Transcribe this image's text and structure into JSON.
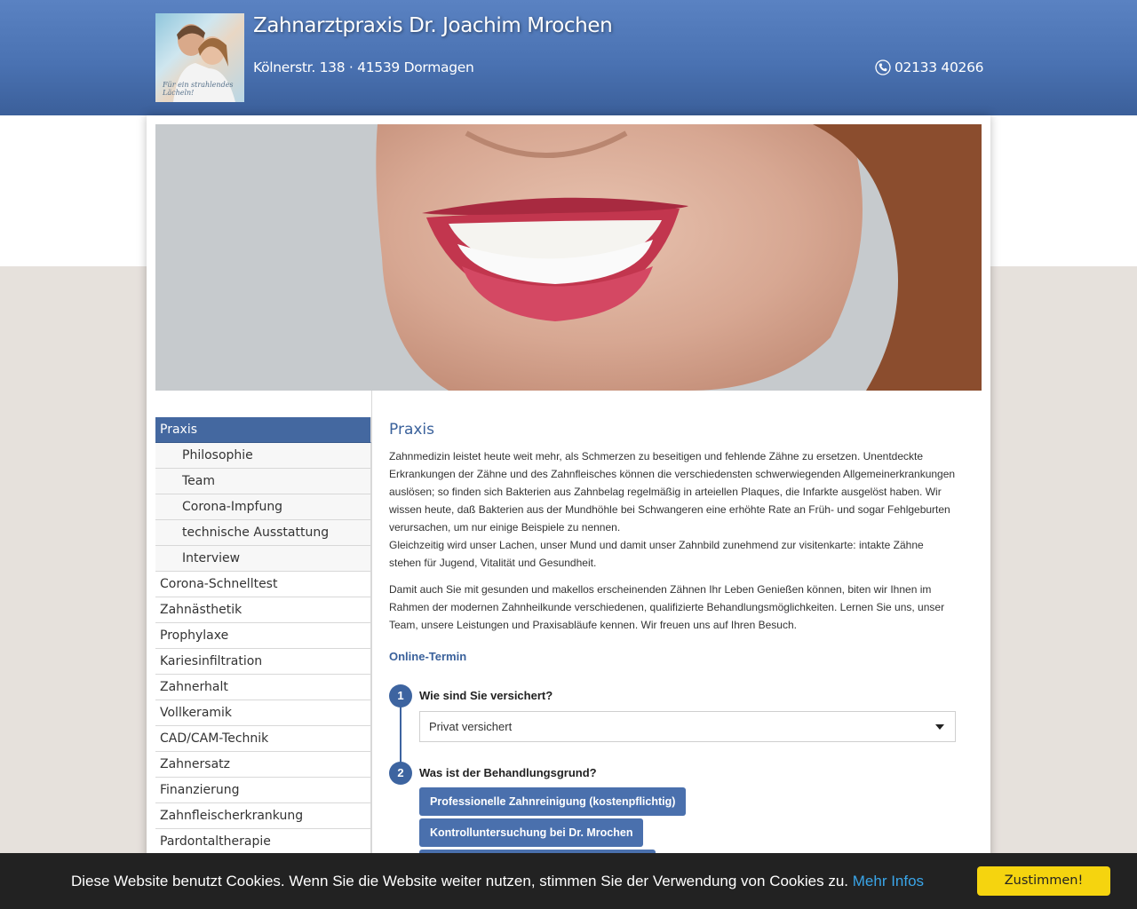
{
  "header": {
    "title": "Zahnarztpraxis Dr. Joachim Mrochen",
    "address": "Kölnerstr. 138 · 41539 Dormagen",
    "phone": "02133 40266",
    "logo_script": "Für ein strahlendes Lächeln!"
  },
  "hero": {
    "alt": "Lächelnde Frau mit weißen Zähnen"
  },
  "sidebar": {
    "items": [
      {
        "label": "Praxis",
        "active": true
      },
      {
        "label": "Philosophie",
        "sub": true
      },
      {
        "label": "Team",
        "sub": true
      },
      {
        "label": "Corona-Impfung",
        "sub": true
      },
      {
        "label": "technische Ausstattung",
        "sub": true
      },
      {
        "label": "Interview",
        "sub": true
      },
      {
        "label": "Corona-Schnelltest"
      },
      {
        "label": "Zahnästhetik"
      },
      {
        "label": "Prophylaxe"
      },
      {
        "label": "Kariesinfiltration"
      },
      {
        "label": "Zahnerhalt"
      },
      {
        "label": "Vollkeramik"
      },
      {
        "label": "CAD/CAM-Technik"
      },
      {
        "label": "Zahnersatz"
      },
      {
        "label": "Finanzierung"
      },
      {
        "label": "Zahnfleischerkrankung"
      },
      {
        "label": "Pardontaltherapie"
      }
    ]
  },
  "content": {
    "heading": "Praxis",
    "paragraph1": "Zahnmedizin leistet heute weit mehr, als Schmerzen zu beseitigen und fehlende Zähne zu ersetzen. Unentdeckte Erkrankungen der Zähne und des Zahnfleisches können die verschiedensten schwerwiegenden Allgemeinerkrankungen auslösen; so finden sich Bakterien aus Zahnbelag regelmäßig in arteiellen Plaques, die Infarkte ausgelöst haben. Wir wissen heute, daß Bakterien aus der Mundhöhle bei Schwangeren eine erhöhte Rate an Früh- und sogar Fehlgeburten verursachen, um nur einige Beispiele zu nennen.",
    "paragraph1b": "Gleichzeitig wird unser Lachen, unser Mund und damit unser Zahnbild zunehmend zur visitenkarte: intakte Zähne stehen für Jugend, Vitalität und Gesundheit.",
    "paragraph2": "Damit auch Sie mit gesunden und makellos erscheinenden Zähnen Ihr Leben Genießen können, biten wir Ihnen im Rahmen der modernen Zahnheilkunde verschiedenen, qualifizierte Behandlungsmöglichkeiten. Lernen Sie uns, unser Team, unsere Leistungen und Praxisabläufe kennen. Wir freuen uns auf Ihren Besuch.",
    "online_title": "Online-Termin",
    "step1": {
      "num": "1",
      "label": "Wie sind Sie versichert?",
      "selected": "Privat versichert"
    },
    "step2": {
      "num": "2",
      "label": "Was ist der Behandlungsgrund?",
      "options": [
        "Professionelle Zahnreinigung (kostenpflichtig)",
        "Kontrolluntersuchung bei Dr. Mrochen"
      ]
    }
  },
  "cookie": {
    "text": "Diese Website benutzt Cookies. Wenn Sie die Website weiter nutzen, stimmen Sie der Verwendung von Cookies zu.",
    "link": "Mehr Infos",
    "button": "Zustimmen!"
  },
  "colors": {
    "header_blue": "#4a72b2",
    "nav_active": "#4468a0",
    "heading_blue": "#3a619b",
    "cookie_button": "#f5d40f",
    "cookie_link": "#3aa5e8"
  }
}
